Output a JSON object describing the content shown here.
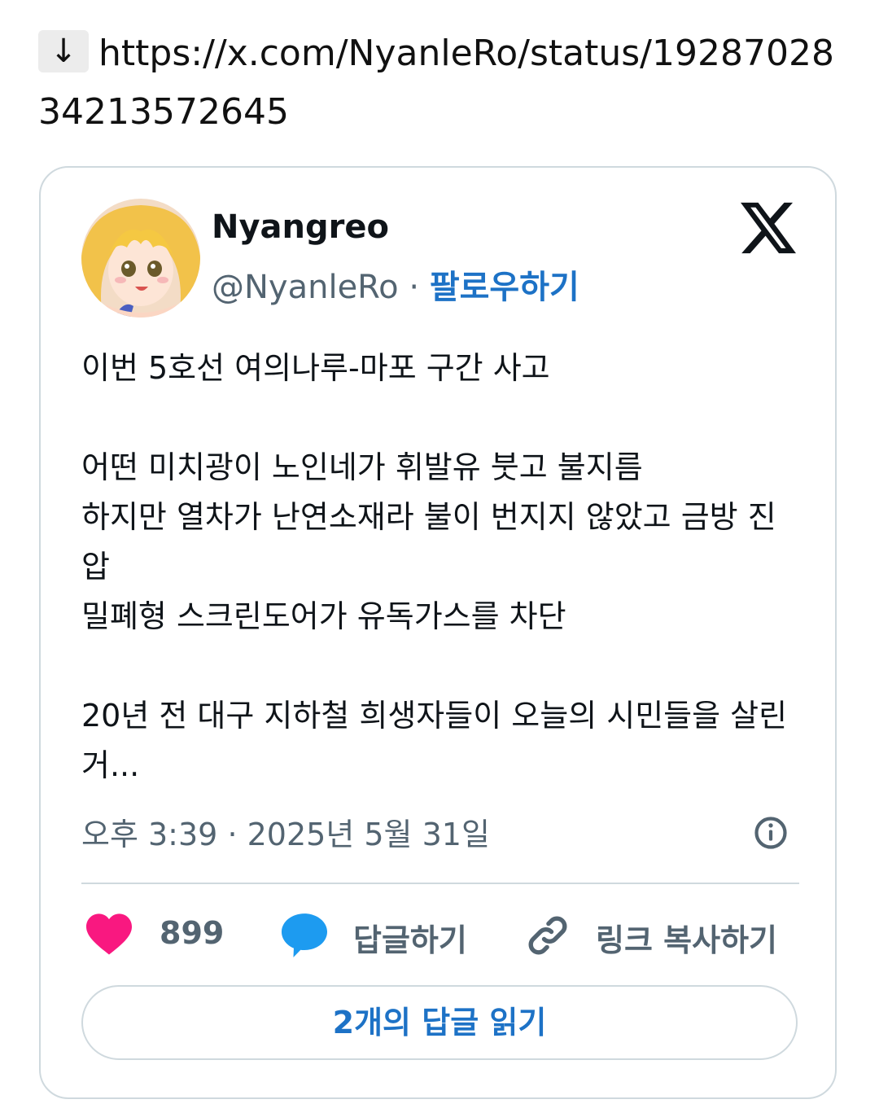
{
  "link": {
    "arrow": "↓",
    "url": "https://x.com/NyanleRo/status/1928702834213572645"
  },
  "tweet": {
    "author": {
      "display_name": "Nyangreo",
      "handle": "@NyanleRo",
      "separator": "·",
      "follow_label": "팔로우하기",
      "avatar_icon": "anime-avatar"
    },
    "logo_icon": "x-logo-icon",
    "lines": [
      "이번 5호선 여의나루-마포 구간 사고",
      "",
      "어떤 미치광이 노인네가 휘발유 붓고 불지름",
      "하지만 열차가 난연소재라 불이 번지지 않았고 금방 진압",
      "밀폐형 스크린도어가 유독가스를 차단",
      "",
      "20년 전 대구 지하철 희생자들이 오늘의 시민들을 살린거..."
    ],
    "time": "오후 3:39",
    "date": "2025년 5월 31일",
    "meta_separator": "·",
    "info_icon": "info-icon"
  },
  "actions": {
    "like_icon": "heart-icon",
    "like_count": "899",
    "reply_icon": "speech-bubble-icon",
    "reply_label": "답글하기",
    "copy_icon": "link-icon",
    "copy_label": "링크 복사하기"
  },
  "read_replies_label": "2개의 답글 읽기",
  "colors": {
    "accent": "#1d72c6",
    "like": "#f91880",
    "reply": "#1d9bf0",
    "muted": "#536471",
    "border": "#cfd9de"
  }
}
